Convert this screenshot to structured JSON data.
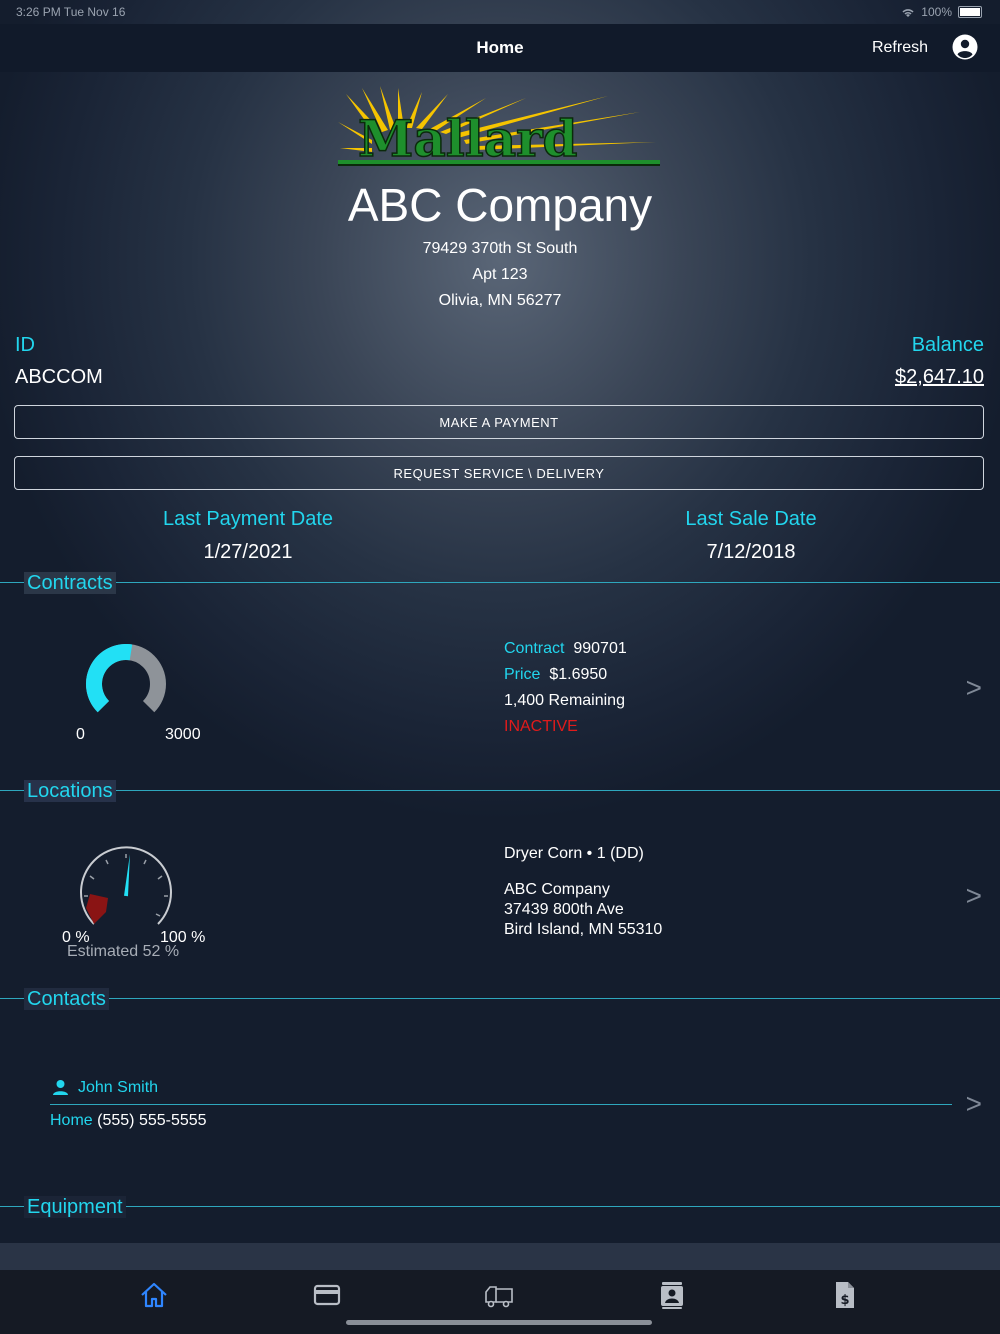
{
  "status_bar": {
    "time": "3:26 PM  Tue Nov 16",
    "battery": "100%"
  },
  "nav": {
    "title": "Home",
    "refresh": "Refresh"
  },
  "logo": {
    "text": "Mallard"
  },
  "company": {
    "name": "ABC Company",
    "address_line1": "79429 370th St South",
    "address_line2": "Apt 123",
    "address_line3": "Olivia, MN 56277"
  },
  "account": {
    "id_label": "ID",
    "id_value": "ABCCOM",
    "balance_label": "Balance",
    "balance_value": "$2,647.10"
  },
  "buttons": {
    "make_payment": "MAKE A PAYMENT",
    "request_service": "REQUEST SERVICE \\ DELIVERY"
  },
  "dates": {
    "last_payment_label": "Last Payment Date",
    "last_payment_value": "1/27/2021",
    "last_sale_label": "Last Sale Date",
    "last_sale_value": "7/12/2018"
  },
  "contracts": {
    "title": "Contracts",
    "gauge_min": "0",
    "gauge_max": "3000",
    "gauge_fraction": 0.533,
    "contract_label": "Contract",
    "contract_value": "990701",
    "price_label": "Price",
    "price_value": "$1.6950",
    "remaining": "1,400 Remaining",
    "status": "INACTIVE"
  },
  "locations": {
    "title": "Locations",
    "gauge_min": "0 %",
    "gauge_max": "100 %",
    "estimated": "Estimated 52 %",
    "estimated_percent": 52,
    "tank": "Dryer Corn • 1 (DD)",
    "name": "ABC Company",
    "street": "37439 800th Ave",
    "city": "Bird Island, MN  55310"
  },
  "contacts": {
    "title": "Contacts",
    "name": "John Smith",
    "phone_label": "Home",
    "phone_value": "(555) 555-5555"
  },
  "equipment": {
    "title": "Equipment"
  },
  "chevron": ">",
  "colors": {
    "accent": "#22d6ee",
    "inactive": "#e01b1b",
    "tab_active": "#2f86ff"
  },
  "tabs": [
    {
      "icon": "home-icon",
      "active": true
    },
    {
      "icon": "credit-card-icon",
      "active": false
    },
    {
      "icon": "delivery-truck-icon",
      "active": false
    },
    {
      "icon": "contact-card-icon",
      "active": false
    },
    {
      "icon": "invoice-icon",
      "active": false
    }
  ]
}
